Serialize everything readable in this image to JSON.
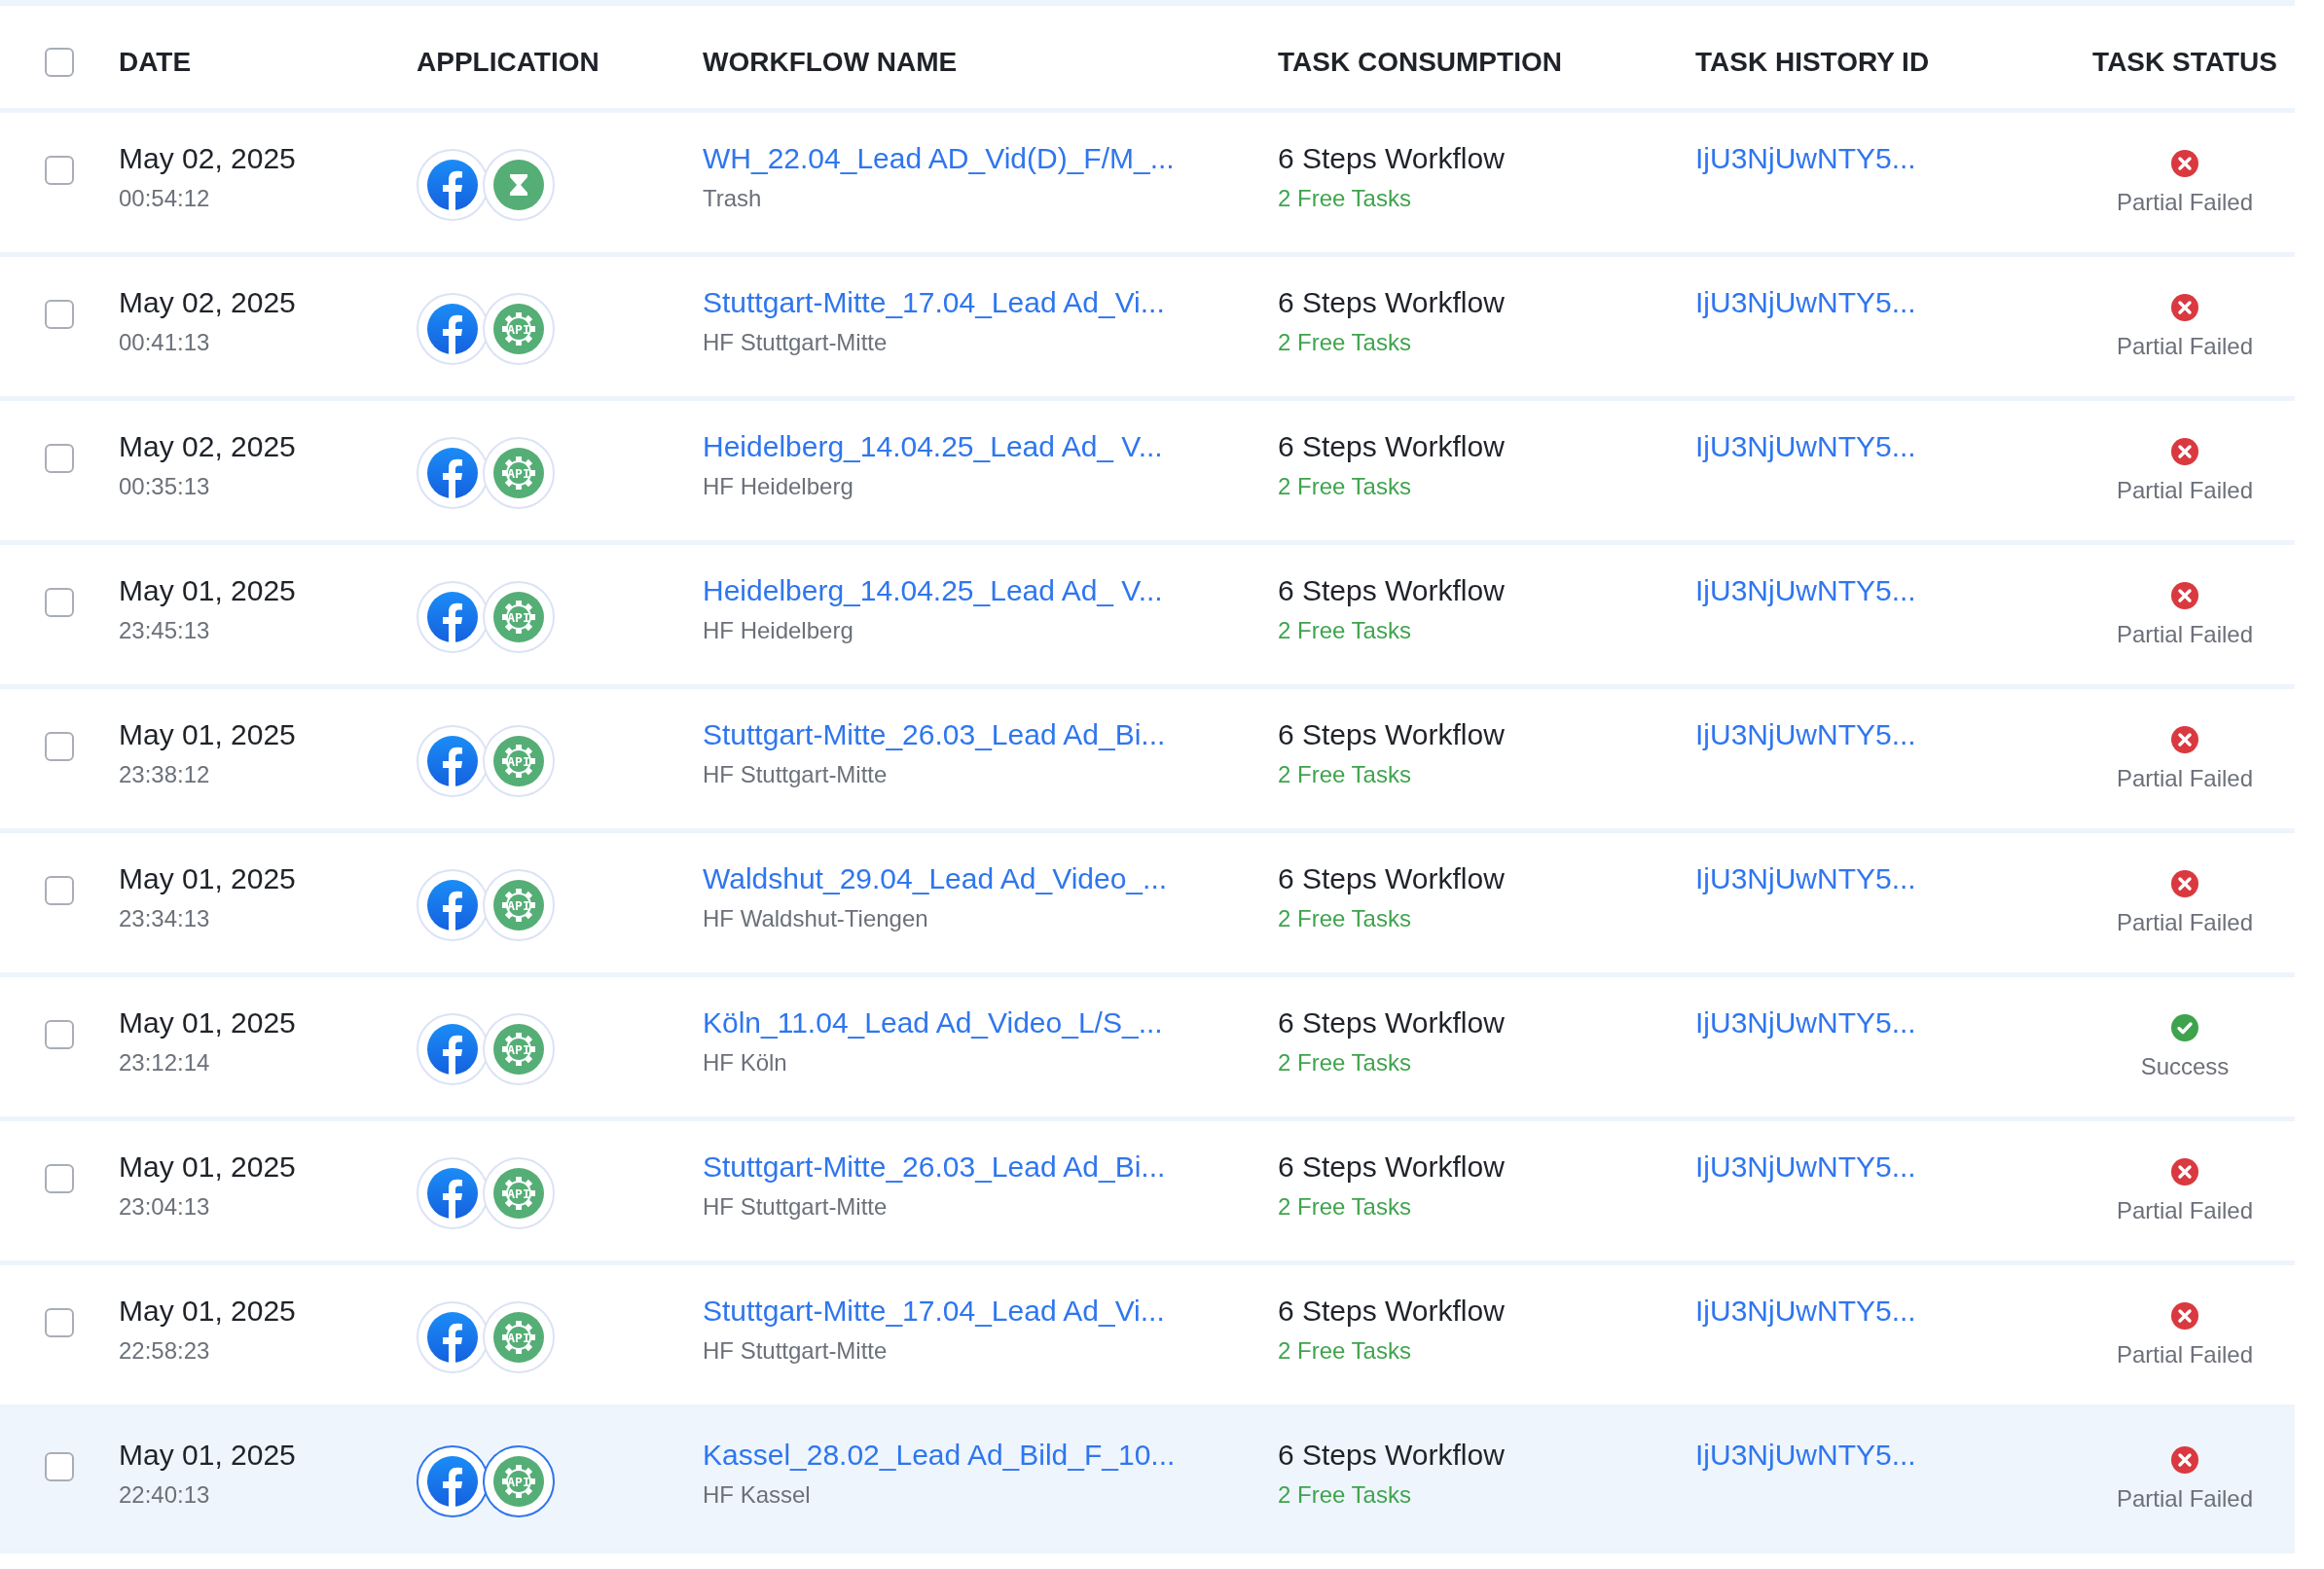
{
  "table": {
    "header_checkbox": {
      "checked": false
    },
    "columns": [
      "DATE",
      "APPLICATION",
      "WORKFLOW NAME",
      "TASK CONSUMPTION",
      "TASK HISTORY ID",
      "TASK STATUS"
    ],
    "rows": [
      {
        "checked": false,
        "selected": false,
        "date": "May 02, 2025",
        "time": "00:54:12",
        "apps": [
          {
            "kind": "facebook"
          },
          {
            "kind": "hourglass"
          }
        ],
        "workflow": "WH_22.04_Lead AD_Vid(D)_F/M_...",
        "folder": "Trash",
        "steps": "6 Steps Workflow",
        "free": "2 Free Tasks",
        "history_id": "IjU3NjUwNTY5...",
        "status": {
          "kind": "failed",
          "label": "Partial Failed"
        }
      },
      {
        "checked": false,
        "selected": false,
        "date": "May 02, 2025",
        "time": "00:41:13",
        "apps": [
          {
            "kind": "facebook"
          },
          {
            "kind": "api",
            "label": "API"
          }
        ],
        "workflow": "Stuttgart-Mitte_17.04_Lead Ad_Vi...",
        "folder": "HF Stuttgart-Mitte",
        "steps": "6 Steps Workflow",
        "free": "2 Free Tasks",
        "history_id": "IjU3NjUwNTY5...",
        "status": {
          "kind": "failed",
          "label": "Partial Failed"
        }
      },
      {
        "checked": false,
        "selected": false,
        "date": "May 02, 2025",
        "time": "00:35:13",
        "apps": [
          {
            "kind": "facebook"
          },
          {
            "kind": "api",
            "label": "API"
          }
        ],
        "workflow": "Heidelberg_14.04.25_Lead Ad_ V...",
        "folder": "HF Heidelberg",
        "steps": "6 Steps Workflow",
        "free": "2 Free Tasks",
        "history_id": "IjU3NjUwNTY5...",
        "status": {
          "kind": "failed",
          "label": "Partial Failed"
        }
      },
      {
        "checked": false,
        "selected": false,
        "date": "May 01, 2025",
        "time": "23:45:13",
        "apps": [
          {
            "kind": "facebook"
          },
          {
            "kind": "api",
            "label": "API"
          }
        ],
        "workflow": "Heidelberg_14.04.25_Lead Ad_ V...",
        "folder": "HF Heidelberg",
        "steps": "6 Steps Workflow",
        "free": "2 Free Tasks",
        "history_id": "IjU3NjUwNTY5...",
        "status": {
          "kind": "failed",
          "label": "Partial Failed"
        }
      },
      {
        "checked": false,
        "selected": false,
        "date": "May 01, 2025",
        "time": "23:38:12",
        "apps": [
          {
            "kind": "facebook"
          },
          {
            "kind": "api",
            "label": "API"
          }
        ],
        "workflow": "Stuttgart-Mitte_26.03_Lead Ad_Bi...",
        "folder": "HF Stuttgart-Mitte",
        "steps": "6 Steps Workflow",
        "free": "2 Free Tasks",
        "history_id": "IjU3NjUwNTY5...",
        "status": {
          "kind": "failed",
          "label": "Partial Failed"
        }
      },
      {
        "checked": false,
        "selected": false,
        "date": "May 01, 2025",
        "time": "23:34:13",
        "apps": [
          {
            "kind": "facebook"
          },
          {
            "kind": "api",
            "label": "API"
          }
        ],
        "workflow": "Waldshut_29.04_Lead Ad_Video_...",
        "folder": "HF Waldshut-Tiengen",
        "steps": "6 Steps Workflow",
        "free": "2 Free Tasks",
        "history_id": "IjU3NjUwNTY5...",
        "status": {
          "kind": "failed",
          "label": "Partial Failed"
        }
      },
      {
        "checked": false,
        "selected": false,
        "date": "May 01, 2025",
        "time": "23:12:14",
        "apps": [
          {
            "kind": "facebook"
          },
          {
            "kind": "api",
            "label": "API"
          }
        ],
        "workflow": "Köln_11.04_Lead Ad_Video_L/S_...",
        "folder": "HF Köln",
        "steps": "6 Steps Workflow",
        "free": "2 Free Tasks",
        "history_id": "IjU3NjUwNTY5...",
        "status": {
          "kind": "success",
          "label": "Success"
        }
      },
      {
        "checked": false,
        "selected": false,
        "date": "May 01, 2025",
        "time": "23:04:13",
        "apps": [
          {
            "kind": "facebook"
          },
          {
            "kind": "api",
            "label": "API"
          }
        ],
        "workflow": "Stuttgart-Mitte_26.03_Lead Ad_Bi...",
        "folder": "HF Stuttgart-Mitte",
        "steps": "6 Steps Workflow",
        "free": "2 Free Tasks",
        "history_id": "IjU3NjUwNTY5...",
        "status": {
          "kind": "failed",
          "label": "Partial Failed"
        }
      },
      {
        "checked": false,
        "selected": false,
        "date": "May 01, 2025",
        "time": "22:58:23",
        "apps": [
          {
            "kind": "facebook"
          },
          {
            "kind": "api",
            "label": "API"
          }
        ],
        "workflow": "Stuttgart-Mitte_17.04_Lead Ad_Vi...",
        "folder": "HF Stuttgart-Mitte",
        "steps": "6 Steps Workflow",
        "free": "2 Free Tasks",
        "history_id": "IjU3NjUwNTY5...",
        "status": {
          "kind": "failed",
          "label": "Partial Failed"
        }
      },
      {
        "checked": false,
        "selected": true,
        "date": "May 01, 2025",
        "time": "22:40:13",
        "apps": [
          {
            "kind": "facebook"
          },
          {
            "kind": "api",
            "label": "API"
          }
        ],
        "workflow": "Kassel_28.02_Lead Ad_Bild_F_10...",
        "folder": "HF Kassel",
        "steps": "6 Steps Workflow",
        "free": "2 Free Tasks",
        "history_id": "IjU3NjUwNTY5...",
        "status": {
          "kind": "failed",
          "label": "Partial Failed"
        }
      }
    ]
  }
}
